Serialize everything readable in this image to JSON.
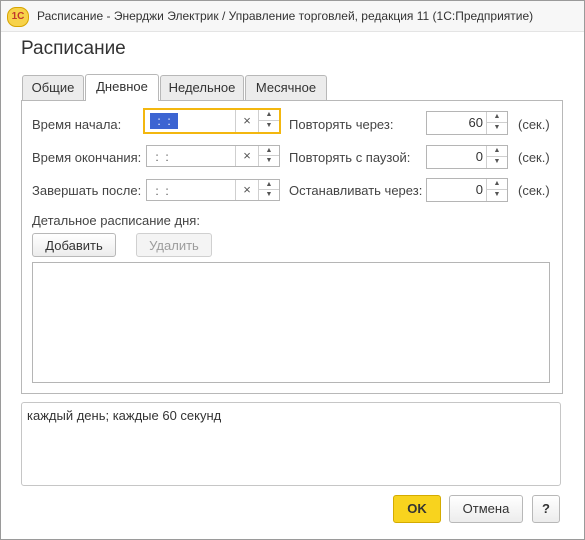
{
  "window": {
    "title": "Расписание - Энерджи Электрик / Управление торговлей, редакция 11  (1С:Предприятие)",
    "logo_text": "1С"
  },
  "form": {
    "title": "Расписание"
  },
  "tabs": [
    {
      "label": "Общие",
      "active": false
    },
    {
      "label": "Дневное",
      "active": true
    },
    {
      "label": "Недельное",
      "active": false
    },
    {
      "label": "Месячное",
      "active": false
    }
  ],
  "daily": {
    "start_time": {
      "label": "Время начала:",
      "value": " :  : "
    },
    "end_time": {
      "label": "Время окончания:",
      "value": " :  : "
    },
    "finish_after": {
      "label": "Завершать после:",
      "value": " :  : "
    },
    "repeat_every": {
      "label": "Повторять через:",
      "value": "60",
      "unit": "(сек.)"
    },
    "repeat_pause": {
      "label": "Повторять с паузой:",
      "value": "0",
      "unit": "(сек.)"
    },
    "stop_after": {
      "label": "Останавливать через:",
      "value": "0",
      "unit": "(сек.)"
    },
    "detailed_label": "Детальное расписание дня:",
    "add_button": "Добавить",
    "delete_button": "Удалить",
    "clear_glyph": "×",
    "spin_up_glyph": "▲",
    "spin_down_glyph": "▼"
  },
  "summary": {
    "text": "каждый день; каждые 60 секунд"
  },
  "footer": {
    "ok": "OK",
    "cancel": "Отмена",
    "help": "?"
  },
  "colors": {
    "accent": "#f8d31e",
    "focus_border": "#f3b70f",
    "selection": "#3c64d2"
  }
}
